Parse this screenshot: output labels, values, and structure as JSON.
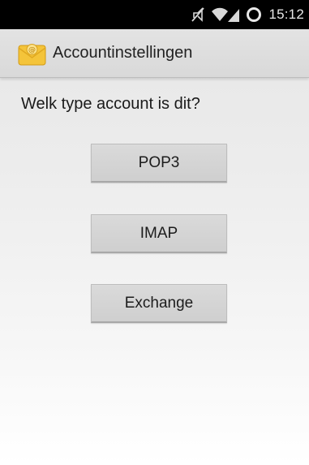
{
  "status_bar": {
    "time": "15:12",
    "icons": [
      "mute-icon",
      "wifi-icon",
      "signal-icon",
      "battery-ring-icon"
    ]
  },
  "action_bar": {
    "icon": "email-app-icon",
    "title": "Accountinstellingen"
  },
  "content": {
    "question": "Welk type account is dit?",
    "buttons": [
      {
        "label": "POP3"
      },
      {
        "label": "IMAP"
      },
      {
        "label": "Exchange"
      }
    ]
  },
  "colors": {
    "status_bar_bg": "#000000",
    "action_bar_bg": "#dddddd",
    "button_bg": "#d4d4d4",
    "icon_yellow": "#f2c233"
  }
}
